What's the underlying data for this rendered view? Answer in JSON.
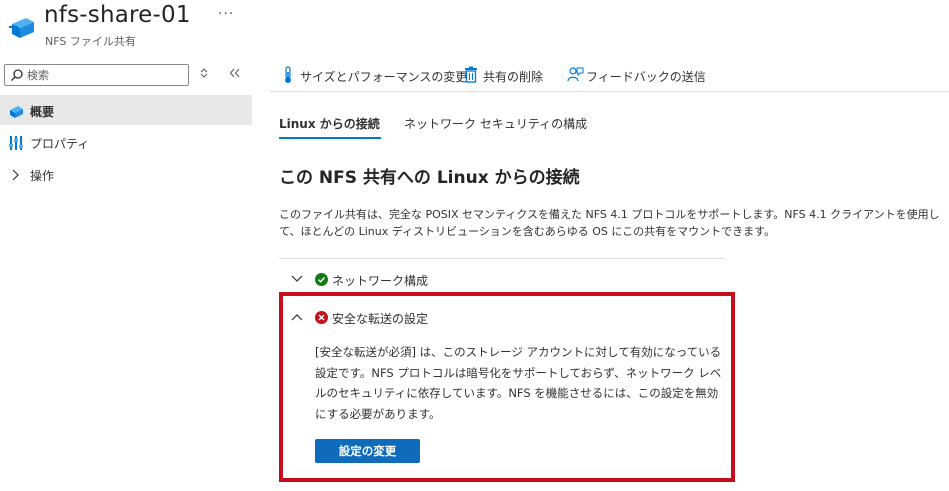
{
  "resource": {
    "title": "nfs-share-01",
    "subtitle": "NFS ファイル共有",
    "more": "···"
  },
  "sidebar": {
    "search_placeholder": "検索",
    "items": [
      {
        "label": "概要",
        "icon": "file-share-icon"
      },
      {
        "label": "プロパティ",
        "icon": "properties-icon"
      },
      {
        "label": "操作",
        "icon": "chevron-right-icon"
      }
    ]
  },
  "toolbar": {
    "size_perf": "サイズとパフォーマンスの変更",
    "delete": "共有の削除",
    "feedback": "フィードバックの送信"
  },
  "tabs": [
    {
      "label": "Linux からの接続",
      "active": true
    },
    {
      "label": "ネットワーク セキュリティの構成",
      "active": false
    }
  ],
  "content": {
    "heading": "この NFS 共有への Linux からの接続",
    "description": "このファイル共有は、完全な POSIX セマンティクスを備えた NFS 4.1 プロトコルをサポートします。NFS 4.1 クライアントを使用して、ほとんどの Linux ディストリビューションを含むあらゆる OS にこの共有をマウントできます。",
    "network": {
      "label": "ネットワーク構成",
      "status": "success"
    },
    "secure": {
      "label": "安全な転送の設定",
      "status": "error",
      "text": "[安全な転送が必須] は、このストレージ アカウントに対して有効になっている設定です。NFS プロトコルは暗号化をサポートしておらず、ネットワーク レベルのセキュリティに依存しています。NFS を機能させるには、この設定を無効にする必要があります。",
      "button": "設定の変更"
    }
  },
  "colors": {
    "accent": "#0078d4",
    "button": "#0f6cbd",
    "success": "#107c10",
    "error": "#c50f1f"
  }
}
